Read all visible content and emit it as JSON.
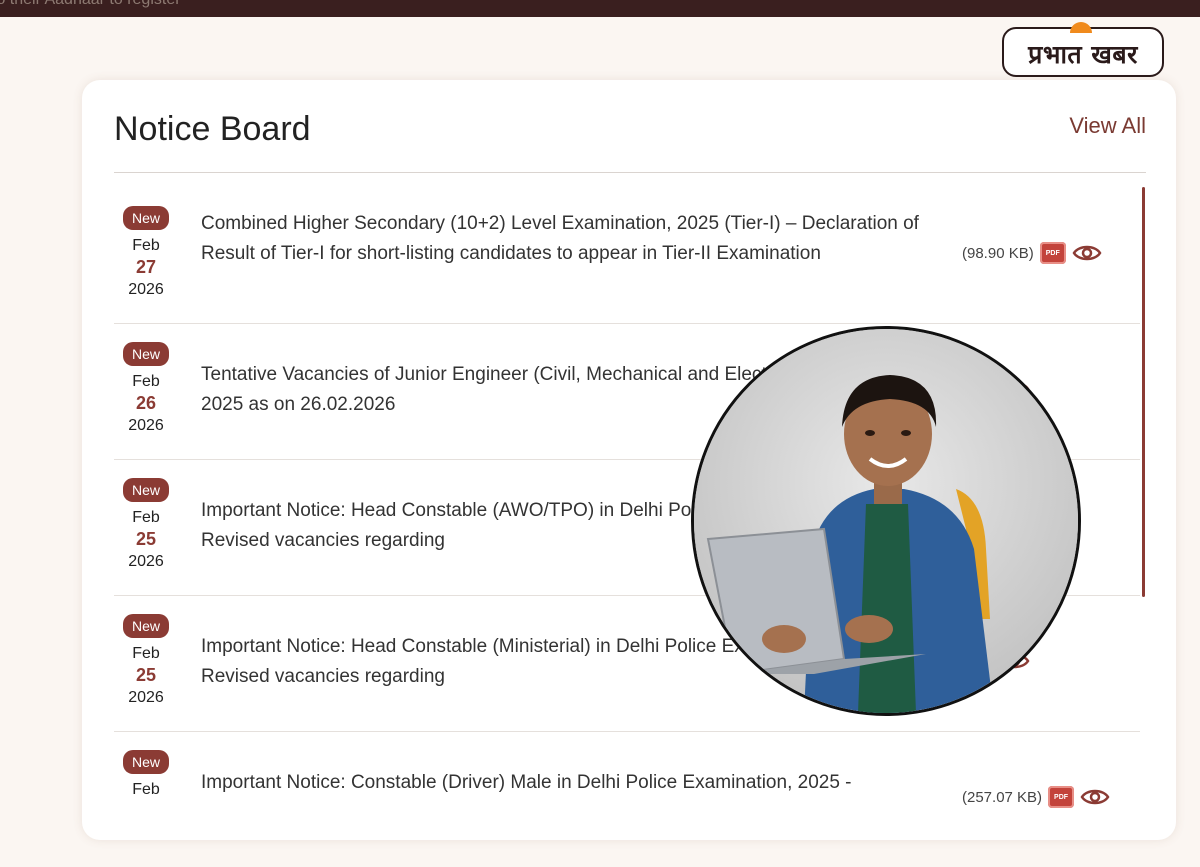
{
  "topbar": {
    "text": "to their Aadhaar to register"
  },
  "logo": {
    "text": "प्रभात खबर"
  },
  "notice_board": {
    "title": "Notice Board",
    "view_all": "View All",
    "items": [
      {
        "badge": "New",
        "month": "Feb",
        "day": "27",
        "year": "2026",
        "text": "Combined Higher Secondary (10+2) Level Examination, 2025 (Tier-I) – Declaration of Result of Tier-I for short-listing candidates to appear in Tier-II Examination",
        "size": "(98.90 KB)"
      },
      {
        "badge": "New",
        "month": "Feb",
        "day": "26",
        "year": "2026",
        "text": "Tentative Vacancies of Junior Engineer (Civil, Mechanical and Electrical) Examination, 2025 as on 26.02.2026",
        "size": ""
      },
      {
        "badge": "New",
        "month": "Feb",
        "day": "25",
        "year": "2026",
        "text": "Important Notice: Head Constable (AWO/TPO) in Delhi Police Examination, 2025 - Revised vacancies regarding",
        "size": ""
      },
      {
        "badge": "New",
        "month": "Feb",
        "day": "25",
        "year": "2026",
        "text": "Important Notice: Head Constable (Ministerial) in Delhi Police Examination, 2025 - Revised vacancies regarding",
        "size": ""
      },
      {
        "badge": "New",
        "month": "Feb",
        "day": "",
        "year": "",
        "text": "Important Notice: Constable (Driver) Male in Delhi Police Examination, 2025 -",
        "size": "(257.07 KB)"
      }
    ]
  },
  "icons": {
    "pdf": "pdf-icon",
    "view": "eye-icon"
  },
  "colors": {
    "accent": "#8b3b34",
    "topbar": "#3a1f1f",
    "background": "#fbf6f2"
  }
}
